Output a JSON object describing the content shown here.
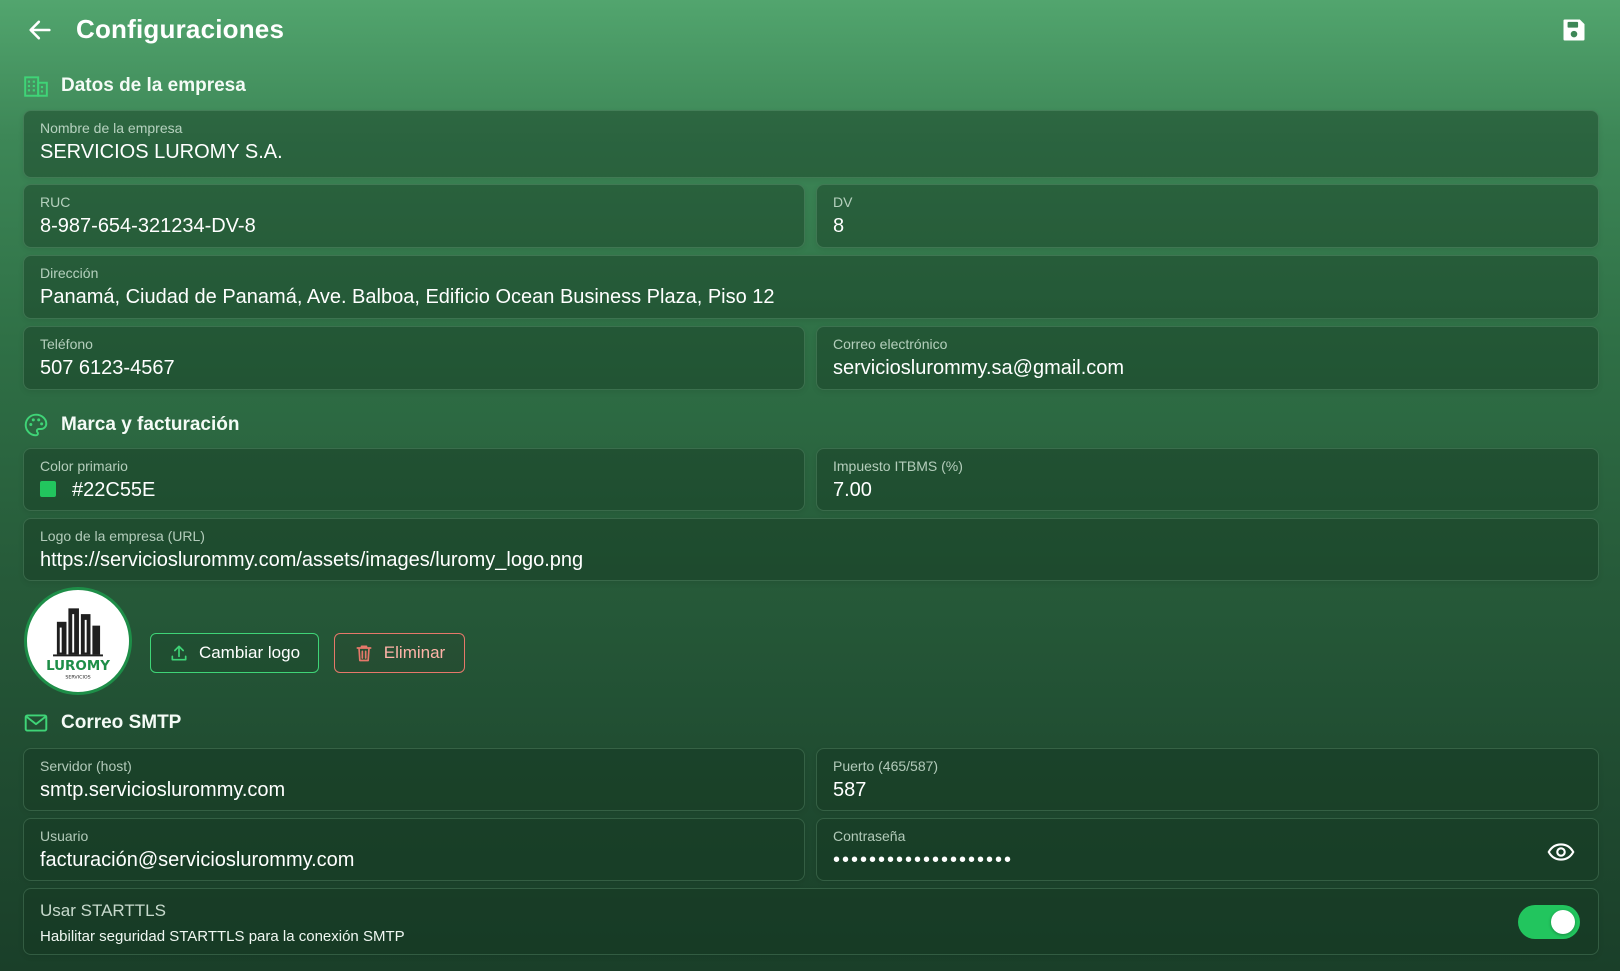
{
  "header": {
    "title": "Configuraciones",
    "back_icon": "arrow-left-icon",
    "save_icon": "floppy-disk-icon"
  },
  "company": {
    "section_title": "Datos de la empresa",
    "section_icon": "building-icon",
    "name": {
      "label": "Nombre de la empresa",
      "value": "SERVICIOS LUROMY S.A."
    },
    "ruc": {
      "label": "RUC",
      "value": "8-987-654-321234-DV-8"
    },
    "dv": {
      "label": "DV",
      "value": "8"
    },
    "address": {
      "label": "Dirección",
      "value": "Panamá, Ciudad de Panamá, Ave. Balboa, Edificio Ocean Business Plaza, Piso 12"
    },
    "phone": {
      "label": "Teléfono",
      "value": "507 6123-4567"
    },
    "email": {
      "label": "Correo electrónico",
      "value": "servicioslurommy.sa@gmail.com"
    }
  },
  "branding": {
    "section_title": "Marca y facturación",
    "section_icon": "palette-icon",
    "primary_color": {
      "label": "Color primario",
      "value": "#22C55E"
    },
    "tax": {
      "label": "Impuesto ITBMS (%)",
      "value": "7.00"
    },
    "logo_url": {
      "label": "Logo de la empresa (URL)",
      "value": "https://servicioslurommy.com/assets/images/luromy_logo.png"
    },
    "logo_text": "LUROMY",
    "logo_subtext": "SERVICIOS",
    "change_logo_label": "Cambiar logo",
    "delete_label": "Eliminar"
  },
  "smtp": {
    "section_title": "Correo SMTP",
    "section_icon": "envelope-icon",
    "host": {
      "label": "Servidor (host)",
      "value": "smtp.servicioslurommy.com"
    },
    "port": {
      "label": "Puerto (465/587)",
      "value": "587"
    },
    "user": {
      "label": "Usuario",
      "value": "facturación@servicioslurommy.com"
    },
    "password": {
      "label": "Contraseña",
      "value": "••••••••••••••••••••"
    },
    "starttls": {
      "label": "Usar STARTTLS",
      "description": "Habilitar seguridad STARTTLS para la conexión SMTP",
      "enabled": true
    }
  },
  "colors": {
    "accent": "#22C55E",
    "danger": "#E6786A"
  }
}
